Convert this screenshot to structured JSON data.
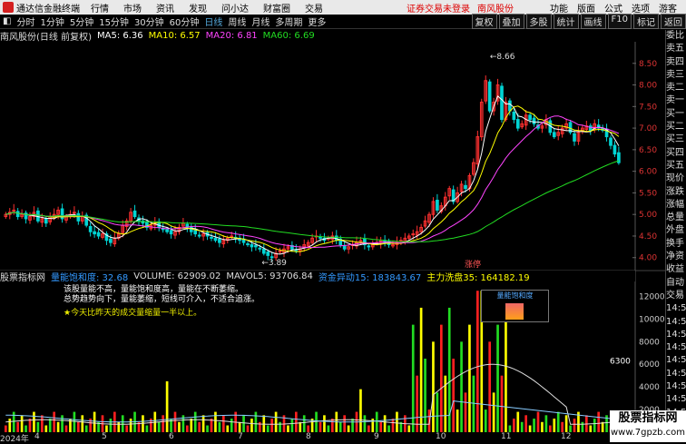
{
  "menubar": {
    "app_name": "通达信金融终端",
    "items": [
      "行情",
      "市场",
      "资讯",
      "发现",
      "问小达",
      "财富圈",
      "交易"
    ],
    "notice": "证券交易未登录",
    "stock": "南风股份",
    "right_items": [
      "功能",
      "版面",
      "公式",
      "选项"
    ],
    "guest": "游客"
  },
  "toolbar": {
    "periods": [
      "分时",
      "1分钟",
      "5分钟",
      "15分钟",
      "30分钟",
      "60分钟",
      "日线",
      "周线",
      "月线",
      "多周期",
      "更多"
    ],
    "active": "日线",
    "right_buttons": [
      "复权",
      "叠加",
      "多股",
      "统计",
      "画线",
      "F10",
      "标记",
      "返回"
    ]
  },
  "infobar": {
    "title": "南风股份(日线 前复权)",
    "ma5": "MA5: 6.36",
    "ma10": "MA10: 6.57",
    "ma20": "MA20: 6.81",
    "ma60": "MA60: 6.69"
  },
  "colors": {
    "ma5": "#ffffff",
    "ma10": "#ffff00",
    "ma20": "#ff44ff",
    "ma60": "#22dd22",
    "up": "#ff3030",
    "down": "#00d4d4",
    "accent": "#3399ff"
  },
  "chart_data": [
    {
      "type": "candlestick",
      "title": "南风股份(日线 前复权)",
      "ylim": [
        3.7,
        9.0
      ],
      "yticks": [
        "8.50",
        "8.00",
        "7.50",
        "7.00",
        "6.50",
        "6.00",
        "5.50",
        "5.00",
        "4.50",
        "4.00"
      ],
      "annotations": [
        "8.66",
        "3.89",
        "涨停"
      ],
      "close": [
        5.0,
        5.05,
        5.1,
        4.95,
        5.0,
        4.9,
        4.95,
        5.05,
        4.85,
        4.9,
        4.8,
        4.95,
        5.0,
        5.1,
        4.9,
        4.95,
        5.0,
        5.05,
        4.85,
        4.95,
        4.75,
        4.6,
        4.55,
        4.5,
        4.55,
        4.4,
        4.35,
        4.45,
        4.55,
        4.75,
        4.85,
        5.05,
        4.95,
        4.85,
        4.8,
        4.7,
        4.75,
        4.8,
        4.7,
        4.65,
        4.6,
        4.55,
        4.6,
        4.7,
        4.8,
        4.7,
        4.6,
        4.55,
        4.5,
        4.55,
        4.5,
        4.45,
        4.4,
        4.35,
        4.4,
        4.45,
        4.5,
        4.45,
        4.4,
        4.35,
        4.3,
        4.25,
        4.25,
        4.2,
        4.1,
        4.05,
        4.0,
        4.1,
        4.15,
        4.2,
        4.25,
        4.2,
        4.15,
        4.2,
        4.3,
        4.35,
        4.45,
        4.5,
        4.45,
        4.4,
        4.45,
        4.5,
        4.4,
        4.3,
        4.2,
        4.25,
        4.3,
        4.35,
        4.4,
        4.3,
        4.25,
        4.3,
        4.35,
        4.4,
        4.35,
        4.3,
        4.3,
        4.35,
        4.4,
        4.45,
        4.5,
        4.55,
        4.6,
        4.7,
        4.85,
        5.0,
        5.3,
        5.1,
        5.2,
        5.4,
        5.6,
        5.3,
        5.5,
        5.7,
        5.6,
        5.9,
        6.2,
        6.8,
        7.6,
        8.1,
        7.4,
        7.6,
        8.0,
        7.2,
        7.6,
        7.4,
        7.2,
        7.0,
        7.1,
        7.3,
        7.2,
        7.1,
        7.0,
        7.05,
        7.2,
        6.9,
        6.8,
        6.9,
        7.0,
        7.1,
        6.9,
        6.7,
        6.9,
        7.0,
        7.05,
        6.95,
        7.1,
        7.0,
        6.95,
        6.8,
        6.6,
        6.4,
        6.2
      ],
      "volume_title": "量能饱和度",
      "volume_ticks": [
        "12000",
        "10000",
        "8000",
        "6000",
        "4000",
        "2000"
      ],
      "volume_marker": "6300"
    }
  ],
  "indicator": {
    "name": "股票指标网",
    "field1": "量能饱和度: 32.68",
    "volume": "VOLUME: 62909.02",
    "mavol5": "MAVOL5: 93706.84",
    "fund": "资金异动15: 183843.67",
    "main": "主力洗盘35: 164182.19",
    "desc_line1": "该股量能不高，量能饱和度高，量能在不断萎缩。",
    "desc_line2": "总势趋势向下，量能萎缩，短线可介入，不适合追涨。",
    "note": "★今天比昨天的成交量缩量一半以上。",
    "legend_label": "量能饱和度"
  },
  "right_panel": [
    "委比",
    "卖五",
    "卖四",
    "卖三",
    "卖二",
    "卖一",
    "买一",
    "买二",
    "买三",
    "买四",
    "买五",
    "现价",
    "涨跌",
    "涨幅",
    "总量",
    "外盘",
    "换手",
    "净资",
    "收益",
    "自动",
    "交易",
    "14:5",
    "14:5",
    "14:5",
    "14:5",
    "14:5",
    "14:5",
    "14:5",
    "14:5",
    "14:5",
    "14:5"
  ],
  "xaxis": [
    "2024年",
    "4",
    "5",
    "6",
    "7",
    "8",
    "9",
    "10",
    "11",
    "12"
  ],
  "watermark": {
    "title": "股票指标网",
    "url": "www.7gpzb.com"
  }
}
